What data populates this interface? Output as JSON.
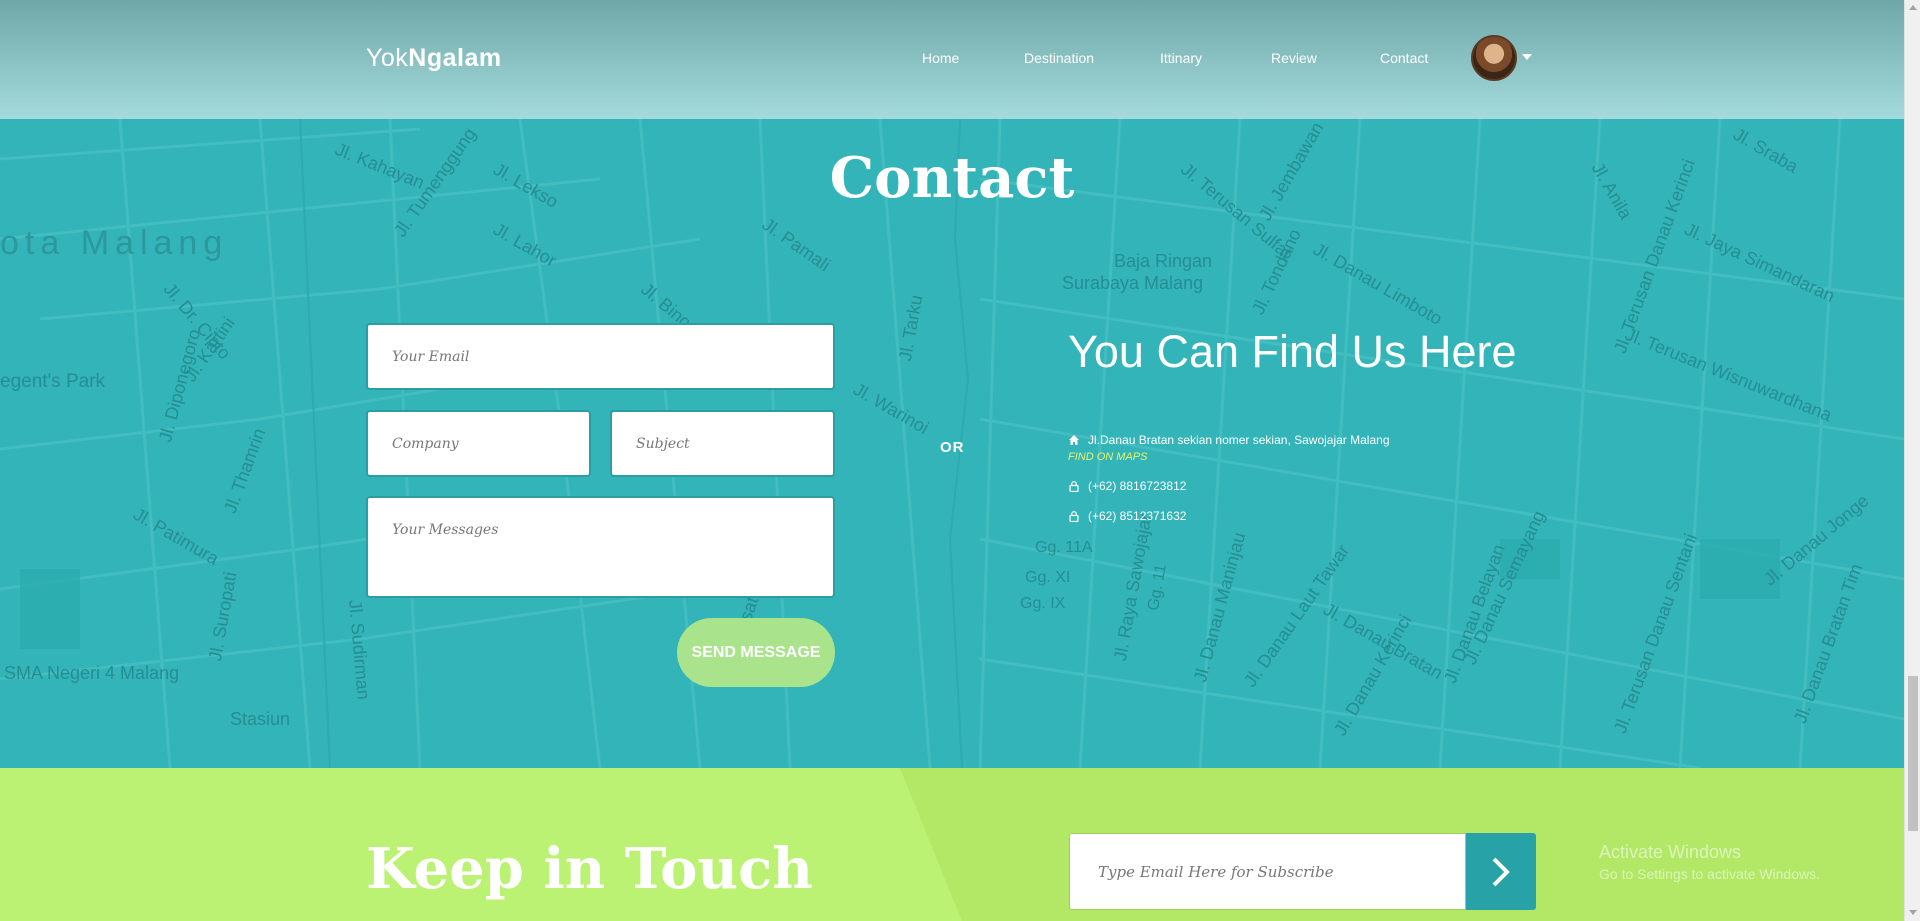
{
  "navbar": {
    "brand_light": "Yok",
    "brand_bold": "Ngalam",
    "links": [
      "Home",
      "Destination",
      "Ittinary",
      "Review",
      "Contact"
    ]
  },
  "map_labels": [
    "ota Malang",
    "egent's Park",
    "SMA Negeri 4 Malang",
    "Stasiun",
    "Baja Ringan",
    "Surabaya Malang",
    "Jl. Kahayan",
    "Jl. Tumenggung",
    "Jl. Lekso",
    "Jl. Lahor",
    "Jl. Pamali",
    "Jl. Binor",
    "Jl. Tarku",
    "Jl. Warinoi",
    "Jl. Dr. Cipto",
    "Jl. Kartini",
    "Jl. Diponegoro",
    "Jl. Thamrin",
    "Jl. Patimura",
    "Jl. Suropati",
    "Jl. Sudirman",
    "Jl. Jembawan",
    "Jl. Terusan Sulfat",
    "Jl. Tondano",
    "Jl. Danau Limboto",
    "Jl. Sraba",
    "Jl. Anila",
    "Jl. Jaya Simandaran",
    "Jl. Terusan Wisnuwardhana",
    "Jl. Terusan Danau Kerinci",
    "Jl. Danau Jonge",
    "Jl. Danau Bratan Tim",
    "Jl. Terusan Danau Sentani",
    "Jl. Danau Semayang",
    "Jl. Danau Belayan",
    "Jl. Danau Bratan",
    "Jl. Danau Kerinci",
    "Jl. Danau Laut Tawar",
    "Jl. Danau Maninjau",
    "Jl. Raya Sawojajar",
    "Jl. Kesatrian",
    "Gg. XI",
    "Gg. IX",
    "Gg. 11A",
    "Gg. 11"
  ],
  "contact": {
    "title": "Contact",
    "email_placeholder": "Your Email",
    "company_placeholder": "Company",
    "subject_placeholder": "Subject",
    "messages_placeholder": "Your Messages",
    "send_label": "SEND MESSAGE",
    "or_label": "OR",
    "find_title": "You Can Find Us Here",
    "address": "Jl.Danau Bratan sekian nomer sekian, Sawojajar Malang",
    "find_maps": "FIND ON MAPS",
    "phone1": "(+62) 8816723812",
    "phone2": "(+62) 8512371632"
  },
  "keep": {
    "title": "Keep in Touch",
    "subscribe_placeholder": "Type Email Here for Subscribe"
  },
  "watermark": {
    "line1": "Activate Windows",
    "line2": "Go to Settings to activate Windows."
  },
  "icons": {
    "address": "home-icon",
    "phone": "lock-icon",
    "subscribe": "chevron-right-icon",
    "avatar_menu": "caret-down-icon"
  },
  "colors": {
    "teal": "#33b4b8",
    "lime": "#bbf273",
    "send_button": "#a9e38b",
    "subscribe_button": "#27a3a8",
    "find_maps": "#e7f36b"
  }
}
